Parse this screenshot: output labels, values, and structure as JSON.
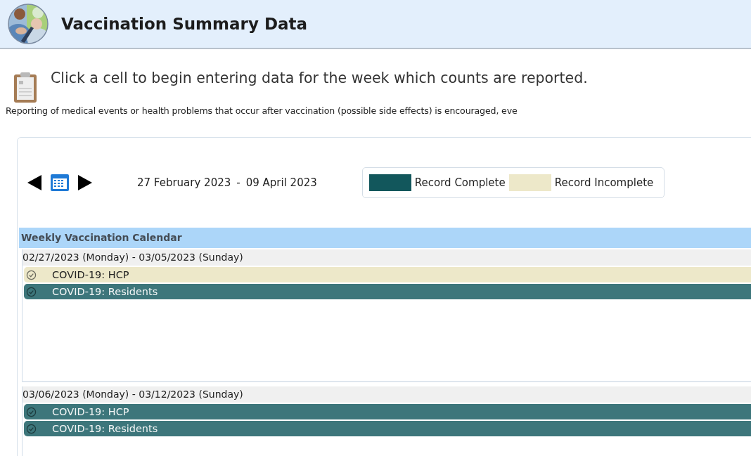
{
  "header": {
    "title": "Vaccination Summary Data"
  },
  "instruction": "Click a cell to begin entering data for the week which counts are reported.",
  "note": "Reporting of medical events or health problems that occur after vaccination (possible side effects) is encouraged, eve",
  "date_range": {
    "start": "27 February 2023",
    "separator": "-",
    "end": "09 April 2023"
  },
  "legend": [
    {
      "label": "Record Complete",
      "color": "#12575c"
    },
    {
      "label": "Record Incomplete",
      "color": "#ede8c9"
    }
  ],
  "calendar": {
    "title": "Weekly Vaccination Calendar",
    "weeks": [
      {
        "label": "02/27/2023 (Monday) - 03/05/2023 (Sunday)",
        "entries": [
          {
            "label": "COVID-19: HCP",
            "complete": false
          },
          {
            "label": "COVID-19: Residents",
            "complete": true
          }
        ]
      },
      {
        "label": "03/06/2023 (Monday) - 03/12/2023 (Sunday)",
        "entries": [
          {
            "label": "COVID-19: HCP",
            "complete": true
          },
          {
            "label": "COVID-19: Residents",
            "complete": true
          }
        ]
      }
    ]
  }
}
